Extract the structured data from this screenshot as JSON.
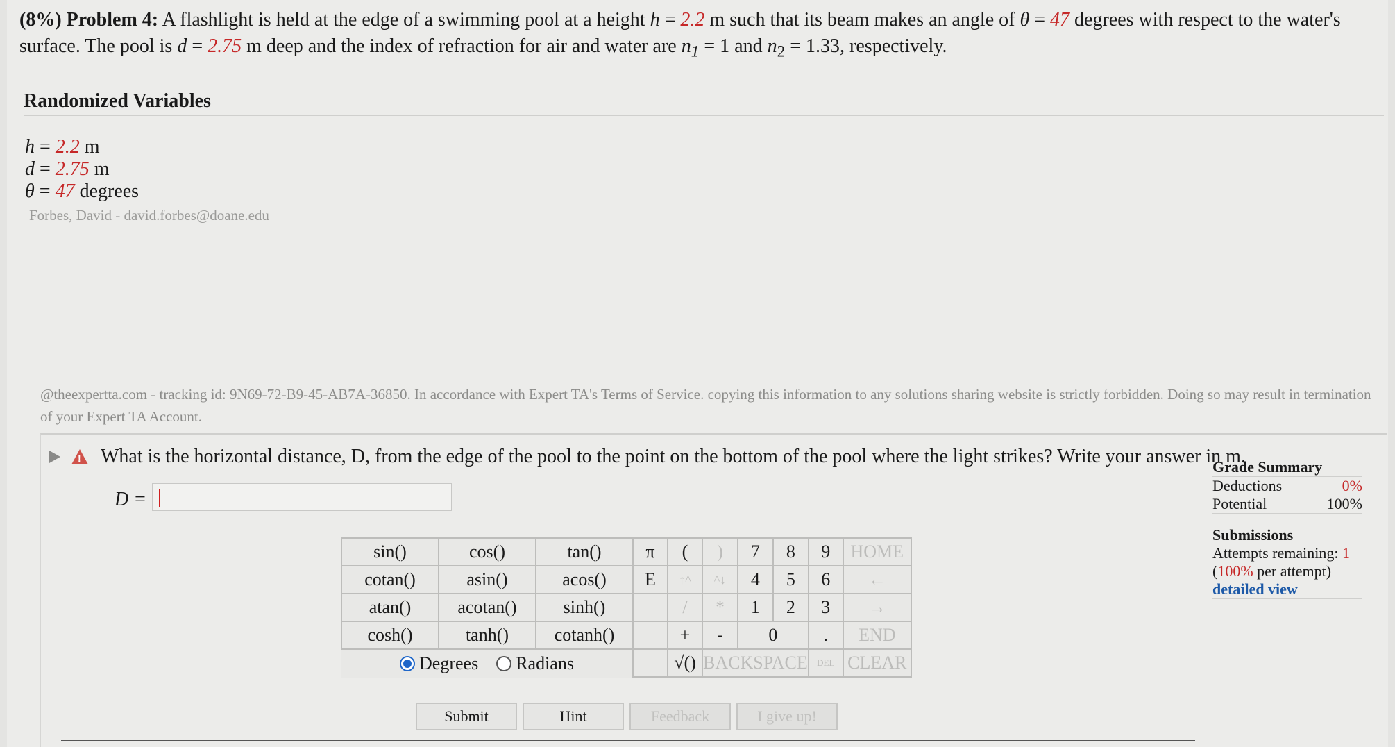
{
  "problem": {
    "weight": "(8%)",
    "title": "Problem 4:",
    "text_1": "A flashlight is held at the edge of a swimming pool at a height ",
    "h_sym": "h",
    "eq": " = ",
    "h_val": "2.2",
    "text_2": " m such that its beam makes an angle of ",
    "theta_sym": "θ",
    "theta_val": "47",
    "text_3": " degrees with respect to the water's surface. The pool is ",
    "d_sym": "d",
    "d_val": "2.75",
    "text_4": " m deep and the index of refraction for air and water are ",
    "n1_sym": "n",
    "n1_sub": "1",
    "n1_val": " = 1 and ",
    "n2_sym": "n",
    "n2_sub": "2",
    "n2_val": " = 1.33, respectively."
  },
  "randomized": {
    "title": "Randomized Variables",
    "vars": [
      {
        "sym": "h",
        "eq": " = ",
        "val": "2.2",
        "unit": " m"
      },
      {
        "sym": "d",
        "eq": " = ",
        "val": "2.75",
        "unit": " m"
      },
      {
        "sym": "θ",
        "eq": " = ",
        "val": "47",
        "unit": " degrees"
      }
    ],
    "author": "Forbes, David - david.forbes@doane.edu"
  },
  "tracking": "@theexpertta.com - tracking id: 9N69-72-B9-45-AB7A-36850. In accordance with Expert TA's Terms of Service. copying this information to any solutions sharing website is strictly forbidden. Doing so may result in termination of your Expert TA Account.",
  "question": {
    "text": "What is the horizontal distance, D, from the edge of the pool to the point on the bottom of the pool where the light strikes? Write your answer in m.",
    "answer_label": "D =",
    "answer_value": ""
  },
  "keypad": {
    "functions": [
      [
        "sin()",
        "cos()",
        "tan()"
      ],
      [
        "cotan()",
        "asin()",
        "acos()"
      ],
      [
        "atan()",
        "acotan()",
        "sinh()"
      ],
      [
        "cosh()",
        "tanh()",
        "cotanh()"
      ]
    ],
    "degrees": "Degrees",
    "radians": "Radians",
    "pi": "π",
    "e": "E",
    "open_paren": "(",
    "close_paren": ")",
    "up": "↑^",
    "down": "^↓",
    "divide": "/",
    "multiply": "*",
    "plus": "+",
    "minus": "-",
    "sqrt": "√()",
    "digits": [
      "7",
      "8",
      "9",
      "4",
      "5",
      "6",
      "1",
      "2",
      "3",
      "0",
      "."
    ],
    "home": "HOME",
    "left": "←",
    "right": "→",
    "end": "END",
    "backspace": "BACKSPACE",
    "del": "DEL",
    "clear": "CLEAR"
  },
  "buttons": {
    "submit": "Submit",
    "hint": "Hint",
    "feedback": "Feedback",
    "give_up": "I give up!"
  },
  "grade": {
    "title": "Grade Summary",
    "deductions_label": "Deductions",
    "deductions_val": "0%",
    "potential_label": "Potential",
    "potential_val": "100%",
    "submissions_title": "Submissions",
    "attempts_label": "Attempts remaining: ",
    "attempts_val": "1",
    "per_attempt_open": "(",
    "per_attempt_val": "100%",
    "per_attempt_text": " per attempt)",
    "detailed_view": "detailed view"
  }
}
